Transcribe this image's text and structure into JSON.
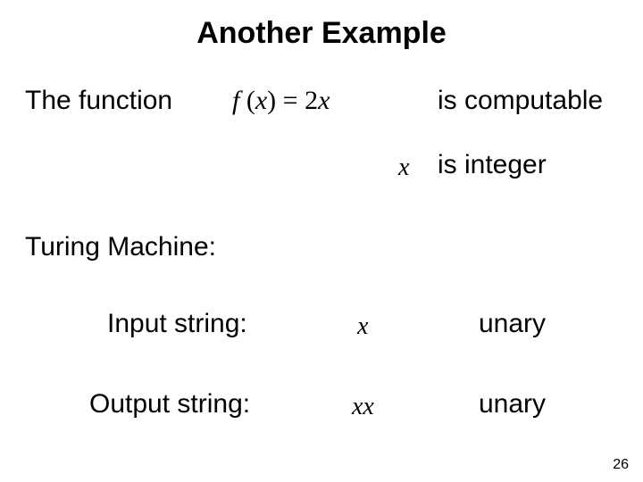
{
  "title": "Another Example",
  "line1_left": "The function",
  "formula_f": "f",
  "formula_open": " (",
  "formula_x": "x",
  "formula_close": ") ",
  "formula_eq": "= 2",
  "formula_x2": "x",
  "line1_right": "is computable",
  "line2_x": "x",
  "line2_text": "is integer",
  "turing": "Turing Machine:",
  "input_label": "Input string:",
  "input_sym": "x",
  "input_unary": "unary",
  "output_label": "Output string:",
  "output_sym": "xx",
  "output_unary": "unary",
  "page_number": "26"
}
